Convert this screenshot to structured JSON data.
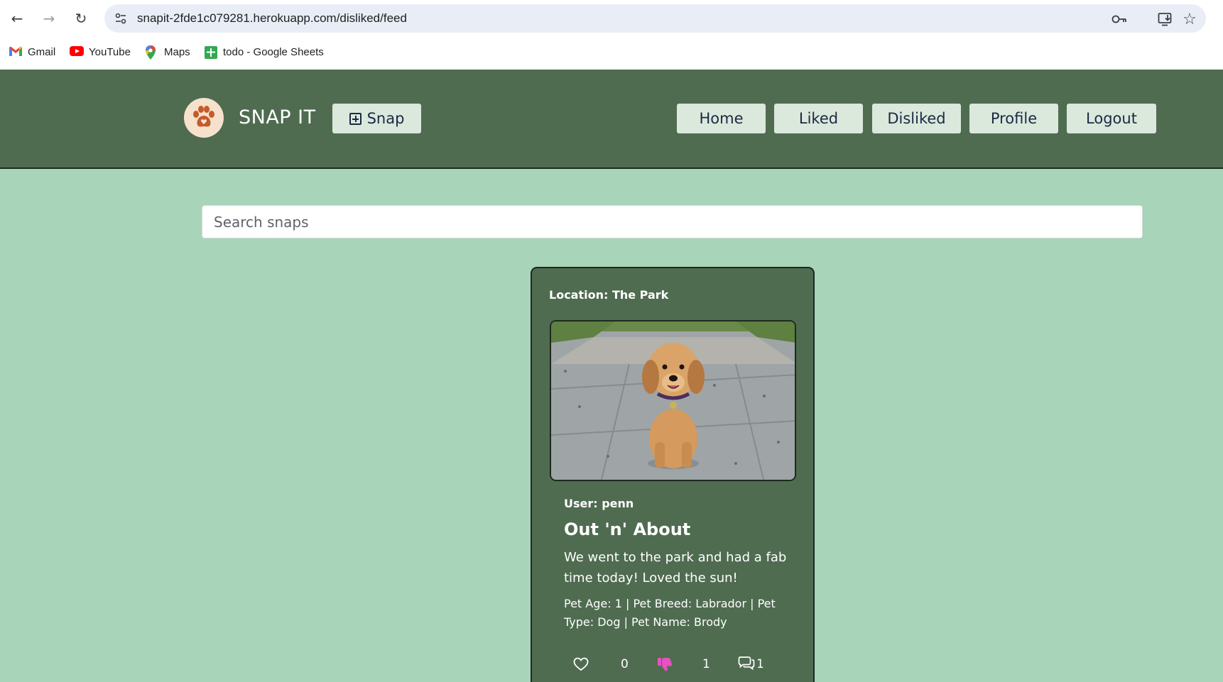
{
  "browser": {
    "url": "snapit-2fde1c079281.herokuapp.com/disliked/feed",
    "bookmarks": [
      {
        "label": "Gmail",
        "icon": "gmail-icon"
      },
      {
        "label": "YouTube",
        "icon": "youtube-icon"
      },
      {
        "label": "Maps",
        "icon": "maps-icon"
      },
      {
        "label": "todo - Google Sheets",
        "icon": "sheets-icon"
      }
    ]
  },
  "header": {
    "brand": "SNAP IT",
    "snap_label": "Snap",
    "nav": {
      "home": "Home",
      "liked": "Liked",
      "disliked": "Disliked",
      "profile": "Profile",
      "logout": "Logout"
    }
  },
  "search": {
    "placeholder": "Search snaps"
  },
  "post": {
    "location": "Location: The Park",
    "user": "User: penn",
    "title": "Out 'n' About",
    "description": "We went to the park and had a fab time today! Loved the sun!",
    "meta": "Pet Age: 1 | Pet Breed: Labrador | Pet Type: Dog | Pet Name: Brody",
    "likes": "0",
    "dislikes": "1",
    "comments": "1"
  },
  "colors": {
    "page_bg": "#a8d4b9",
    "header_bg": "#4f6c50",
    "button_bg": "#dbe8dc",
    "dislike_active": "#e453c0"
  }
}
